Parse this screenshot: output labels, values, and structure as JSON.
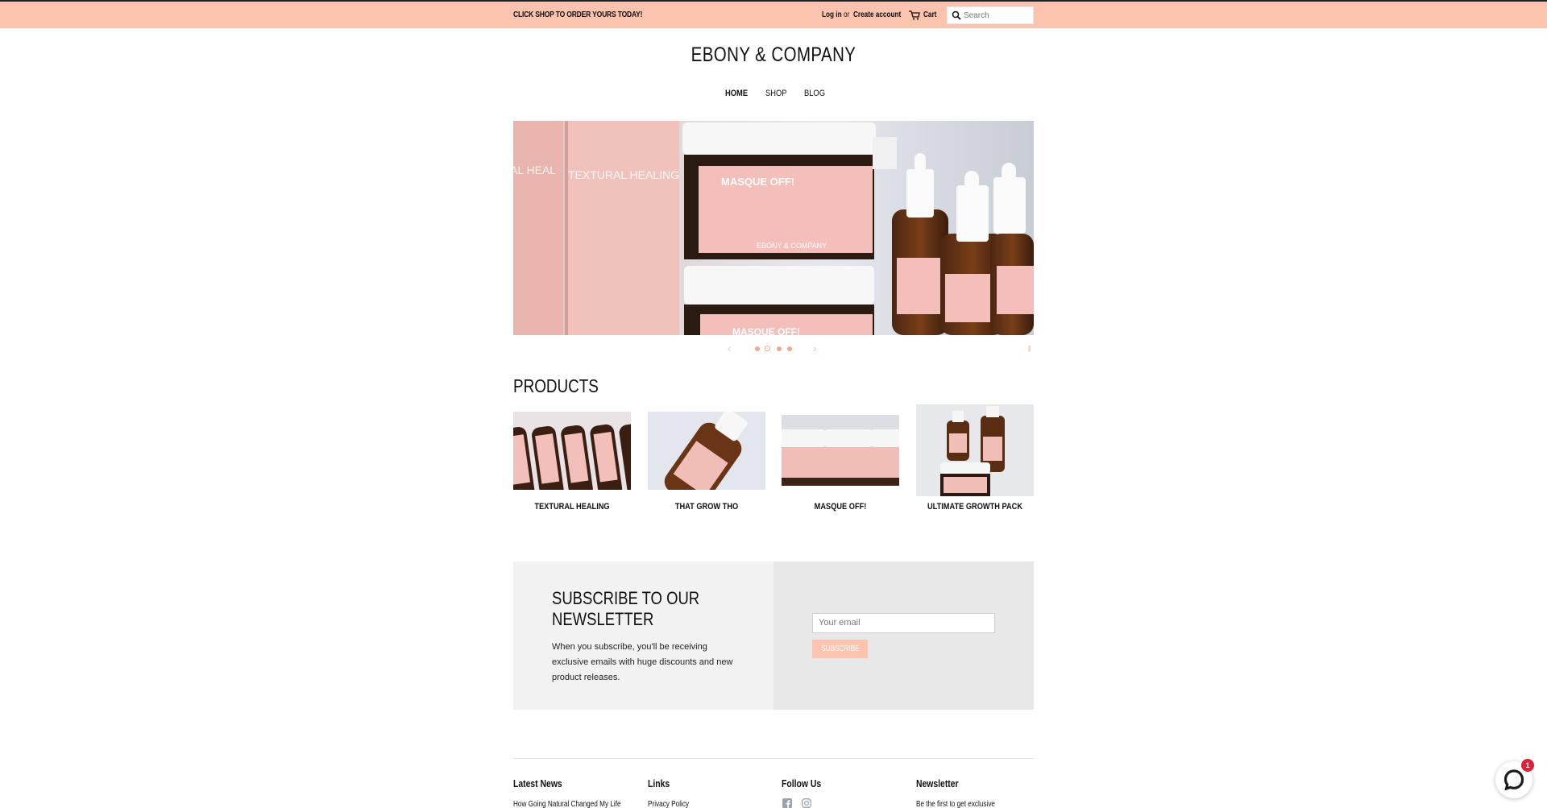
{
  "topbar": {
    "promo": "CLICK SHOP TO ORDER YOURS TODAY!",
    "login": "Log in",
    "or": "or",
    "create_account": "Create account",
    "cart": "Cart",
    "search_placeholder": "Search",
    "bg_color": "#fcc3ae"
  },
  "brand": {
    "name": "EBONY & COMPANY"
  },
  "nav": {
    "items": [
      "HOME",
      "SHOP",
      "BLOG"
    ],
    "active": "HOME"
  },
  "hero": {
    "labels": [
      "AL HEAL",
      "TEXTURAL HEALING",
      "MASQUE OFF!",
      "EBONY & COMPANY",
      "MASQUE OFF!"
    ],
    "slides": 4,
    "current_slide": 2
  },
  "products": {
    "title": "PRODUCTS",
    "items": [
      {
        "name": "TEXTURAL HEALING"
      },
      {
        "name": "THAT GROW THO"
      },
      {
        "name": "MASQUE OFF!"
      },
      {
        "name": "ULTIMATE GROWTH PACK"
      }
    ]
  },
  "newsletter": {
    "title": "SUBSCRIBE TO OUR NEWSLETTER",
    "text": "When you subscribe, you'll be receiving exclusive emails with huge discounts and new product releases.",
    "email_placeholder": "Your email",
    "button": "SUBSCRIBE"
  },
  "footer": {
    "latest_news": {
      "title": "Latest News",
      "item": "How Going Natural Changed My Life"
    },
    "links": {
      "title": "Links",
      "item": "Privacy Policy"
    },
    "follow": {
      "title": "Follow Us",
      "icons": [
        "facebook-icon",
        "instagram-icon"
      ]
    },
    "newsletter": {
      "title": "Newsletter",
      "text": "Be the first to get exclusive"
    }
  },
  "chat": {
    "badge": "1"
  },
  "colors": {
    "accent": "#fcc3ae",
    "dot": "#f0a98d",
    "pink_label": "#f4bfbb"
  }
}
